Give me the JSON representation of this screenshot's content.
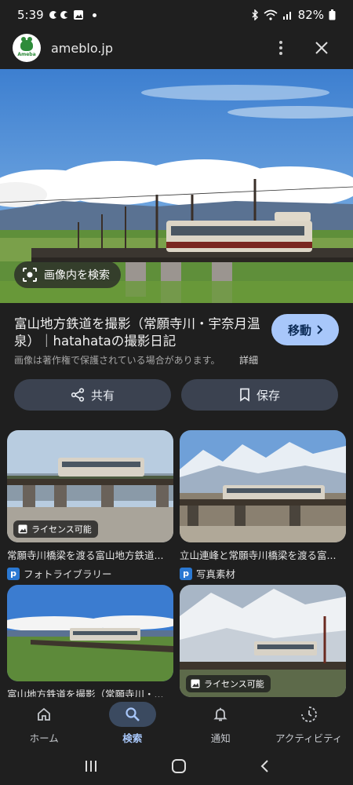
{
  "status_bar": {
    "time": "5:39",
    "battery": "82%"
  },
  "header": {
    "domain": "ameblo.jp",
    "favicon_text": "Ameba"
  },
  "hero": {
    "lens_label": "画像内を検索"
  },
  "result": {
    "title": "富山地方鉄道を撮影（常願寺川・宇奈月温泉）｜hatahataの撮影日記",
    "visit_label": "移動",
    "notice": "画像は著作権で保護されている場合があります。",
    "details_label": "詳細",
    "share_label": "共有",
    "save_label": "保存"
  },
  "cards": [
    {
      "title": "常願寺川橋梁を渡る富山地方鉄道...",
      "source": "フォトライブラリー",
      "license": "ライセンス可能"
    },
    {
      "title": "立山連峰と常願寺川橋梁を渡る富...",
      "source": "写真素材",
      "license": ""
    },
    {
      "title": "富山地方鉄道を撮影（常願寺川・...",
      "source": "",
      "license": ""
    },
    {
      "title": "",
      "source": "",
      "license": "ライセンス可能"
    }
  ],
  "bottom_nav": [
    {
      "label": "ホーム",
      "icon": "home-icon"
    },
    {
      "label": "検索",
      "icon": "search-icon",
      "active": true
    },
    {
      "label": "通知",
      "icon": "bell-icon"
    },
    {
      "label": "アクティビティ",
      "icon": "activity-icon"
    }
  ],
  "colors": {
    "background": "#1f1f1f",
    "accent": "#a8c7fa",
    "chip": "#3b4250"
  }
}
